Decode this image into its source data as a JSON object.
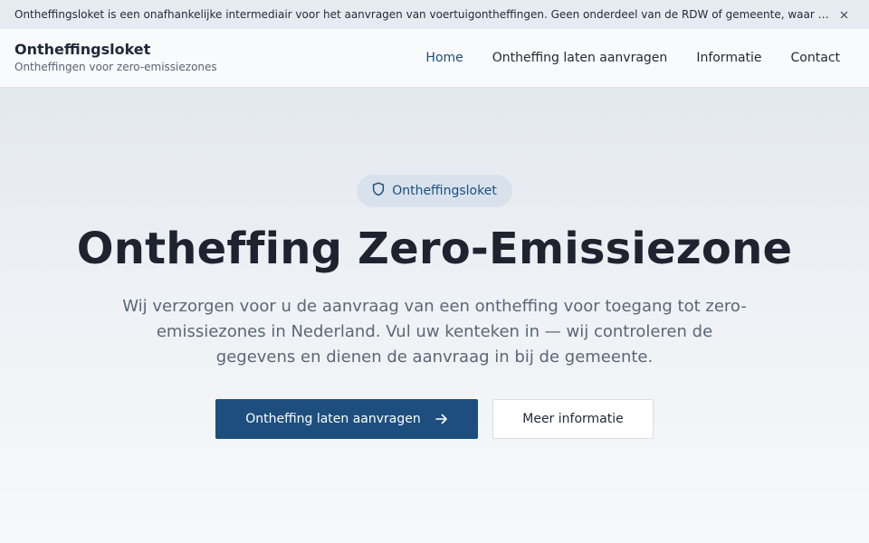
{
  "notice": {
    "text": "Ontheffingsloket is een onafhankelijke intermediair voor het aanvragen van voertuigontheffingen. Geen onderdeel van de RDW of gemeente, waar wij bemiddelen tegen een servicevergoeding.",
    "close_icon": "close-icon"
  },
  "header": {
    "brand_title": "Ontheffingsloket",
    "brand_subtitle": "Ontheffingen voor zero-emissiezones",
    "nav": {
      "home": "Home",
      "apply": "Ontheffing laten aanvragen",
      "info": "Informatie",
      "contact": "Contact"
    }
  },
  "hero": {
    "badge_icon": "shield-icon",
    "badge_label": "Ontheffingsloket",
    "title": "Ontheffing Zero-Emissiezone",
    "description": "Wij verzorgen voor u de aanvraag van een ontheffing voor toegang tot zero-emissiezones in Nederland. Vul uw kenteken in — wij controleren de gegevens en dienen de aanvraag in bij de gemeente.",
    "primary_button": "Ontheffing laten aanvragen",
    "primary_button_icon": "arrow-right-icon",
    "secondary_button": "Meer informatie"
  },
  "colors": {
    "brand": "#1d4e7e",
    "badge_background": "#d9e2ec",
    "notice_background": "#e6ebf1"
  }
}
